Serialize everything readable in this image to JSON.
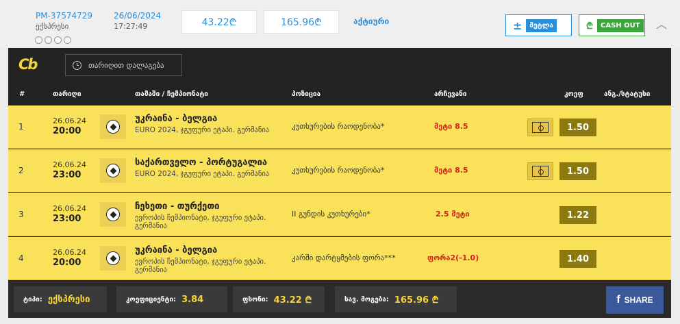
{
  "header": {
    "bet_id": "PM-37574729",
    "bet_type": "ექსპრესი",
    "date": "26/06/2024",
    "time": "17:27:49",
    "stake": "43.22₾",
    "win": "165.96₾",
    "status": "აქტიური",
    "calc_symbol": "±",
    "calc_label": "მეტლა",
    "cashout_icon": "₾",
    "cashout_label": "CASH OUT",
    "chevron": "︿"
  },
  "panel": {
    "logo": "Cb",
    "date_filter": "თარიღით დალაგება"
  },
  "columns": {
    "num": "#",
    "date": "თარიღი",
    "match": "თამაში / ჩემპიონატი",
    "market": "პოზიცია",
    "result": "არჩევანი",
    "odd": "კოეფ",
    "stats": "ანგ./სტატუსი"
  },
  "rows": [
    {
      "num": "1",
      "date": "26.06.24",
      "time": "20:00",
      "match": "უკრაინა - ბელგია",
      "league": "EURO 2024, ჯგუფური ეტაპი. გერმანია",
      "market": "კუთხურების რაოდენობა*",
      "result": "მეტი 8.5",
      "odd": "1.50",
      "has_pitch": true
    },
    {
      "num": "2",
      "date": "26.06.24",
      "time": "23:00",
      "match": "საქართველო - პორტუგალია",
      "league": "EURO 2024, ჯგუფური ეტაპი. გერმანია",
      "market": "კუთხურების რაოდენობა*",
      "result": "მეტი 8.5",
      "odd": "1.50",
      "has_pitch": true
    },
    {
      "num": "3",
      "date": "26.06.24",
      "time": "23:00",
      "match": "ჩეხეთი - თურქეთი",
      "league": "ევროპის ჩემპიონატი, ჯგუფური ეტაპი. გერმანია",
      "market": "II გუნდის კუთხურები*",
      "result": "2.5 მეტი",
      "odd": "1.22",
      "has_pitch": false
    },
    {
      "num": "4",
      "date": "26.06.24",
      "time": "20:00",
      "match": "უკრაინა - ბელგია",
      "league": "ევროპის ჩემპიონატი, ჯგუფური ეტაპი. გერმანია",
      "market": "კარში დარტყმების ფორა***",
      "result": "ფორა2(-1.0)",
      "odd": "1.40",
      "has_pitch": false
    }
  ],
  "footer": {
    "type_label": "ტიპი:",
    "type_value": "ექსპრესი",
    "coef_label": "კოეფიციენტი:",
    "coef_value": "3.84",
    "stake_label": "ფსონი:",
    "stake_value": "43.22 ₾",
    "total_label": "სავ. მოგება:",
    "total_value": "165.96 ₾",
    "share_label": "SHARE",
    "share_icon": "f"
  },
  "colors": {
    "accent_blue": "#2a8fd8",
    "cashout_green": "#3aa53a",
    "row_yellow": "#f9e15a",
    "odd_olive": "#8a7a0f",
    "result_red": "#d6221e",
    "panel_dark": "#232323",
    "facebook": "#3b5998"
  }
}
